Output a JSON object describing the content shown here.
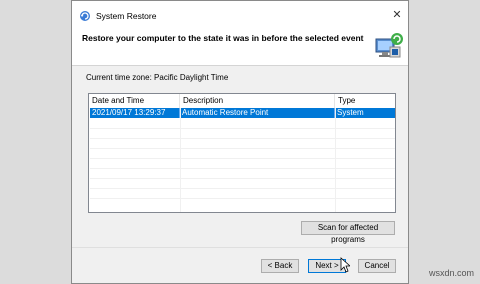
{
  "window": {
    "title": "System Restore"
  },
  "header": {
    "text": "Restore your computer to the state it was in before the selected event"
  },
  "timezone": "Current time zone: Pacific Daylight Time",
  "table": {
    "columns": [
      "Date and Time",
      "Description",
      "Type"
    ],
    "rows": [
      {
        "date": "2021/09/17 13:29:37",
        "description": "Automatic Restore Point",
        "type": "System",
        "selected": true
      }
    ]
  },
  "buttons": {
    "scan": "Scan for affected programs",
    "back": "< Back",
    "next": "Next >",
    "cancel": "Cancel"
  },
  "watermark": "wsxdn.com",
  "colors": {
    "selection": "#0078d7",
    "background": "#f0f0f0"
  },
  "icons": [
    "system-restore-icon",
    "close-icon",
    "restore-computer-icon",
    "mouse-cursor-icon"
  ]
}
